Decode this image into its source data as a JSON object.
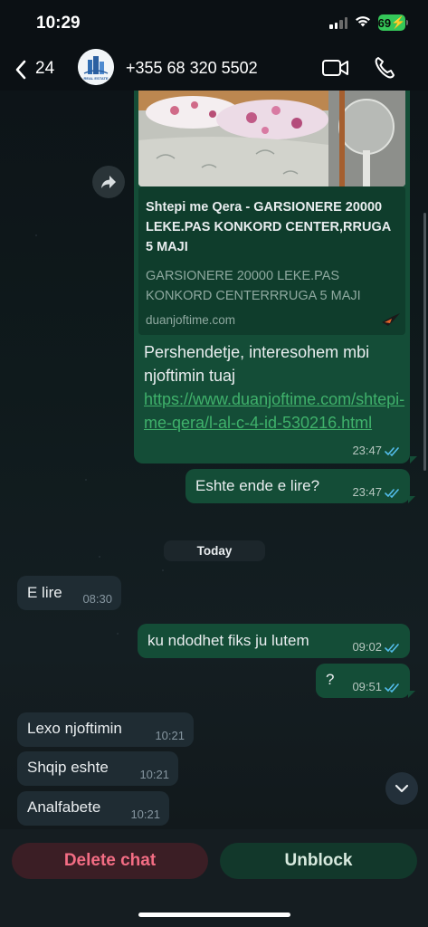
{
  "status_bar": {
    "time": "10:29",
    "battery": "69"
  },
  "header": {
    "back_count": "24",
    "contact_name": "+355 68 320 5502",
    "avatar_caption": "REAL ESTATE"
  },
  "link_preview": {
    "title": "Shtepi me Qera - GARSIONERE  20000 LEKE.PAS KONKORD CENTER,RRUGA 5 MAJI",
    "description": "GARSIONERE  20000 LEKE.PAS KONKORD CENTERRRUGA 5 MAJI",
    "domain": "duanjoftime.com"
  },
  "messages": [
    {
      "id": "m1",
      "direction": "out",
      "text": "Pershendetje, interesohem mbi njoftimin tuaj ",
      "link": "https://www.duanjoftime.com/shtepi-me-qera/l-al-c-4-id-530216.html",
      "time": "23:47"
    },
    {
      "id": "m2",
      "direction": "out",
      "text": "Eshte ende e lire?",
      "time": "23:47"
    },
    {
      "id": "m3",
      "direction": "in",
      "text": "E lire",
      "time": "08:30"
    },
    {
      "id": "m4",
      "direction": "out",
      "text": "ku ndodhet fiks ju lutem",
      "time": "09:02"
    },
    {
      "id": "m5",
      "direction": "out",
      "text": "?",
      "time": "09:51"
    },
    {
      "id": "m6",
      "direction": "in",
      "text": "Lexo njoftimin",
      "time": "10:21"
    },
    {
      "id": "m7",
      "direction": "in",
      "text": "Shqip eshte",
      "time": "10:21"
    },
    {
      "id": "m8",
      "direction": "in",
      "text": "Analfabete",
      "time": "10:21"
    }
  ],
  "day_separator": "Today",
  "actions": {
    "delete_label": "Delete chat",
    "unblock_label": "Unblock"
  },
  "colors": {
    "outgoing_bubble": "#144d37",
    "incoming_bubble": "#1f2c33",
    "link": "#3fb16b",
    "read_ticks": "#53bdeb",
    "delete_text": "#f36d84"
  }
}
